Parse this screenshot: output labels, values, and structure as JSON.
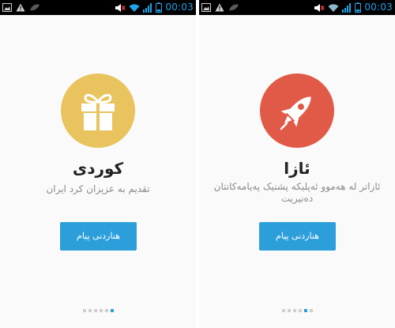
{
  "status_bar": {
    "time": "00:03",
    "colors": {
      "background": "#000000",
      "time": "#1fa3ea",
      "icons": "#1fa3ea"
    }
  },
  "screens": [
    {
      "title": "کوردی",
      "description": "تقدیم به عزیزان کرد ایران",
      "icon": "gift-icon",
      "icon_bg": "#e8c35e",
      "button_label": "هناردنی پیام",
      "pager": {
        "count": 6,
        "active_index": 5
      }
    },
    {
      "title": "ئازا",
      "description": "ئازاتر لە هەموو ئەپلیکە پشنیک پەیامەکانتان دەنیریت",
      "icon": "rocket-icon",
      "icon_bg": "#e05a47",
      "button_label": "هناردنی پیام",
      "pager": {
        "count": 6,
        "active_index": 4
      }
    }
  ],
  "colors": {
    "button": "#2c9fdb",
    "dot_inactive": "#cfcfcf",
    "dot_active": "#2c9fdb",
    "screen_bg": "#fafafa"
  }
}
